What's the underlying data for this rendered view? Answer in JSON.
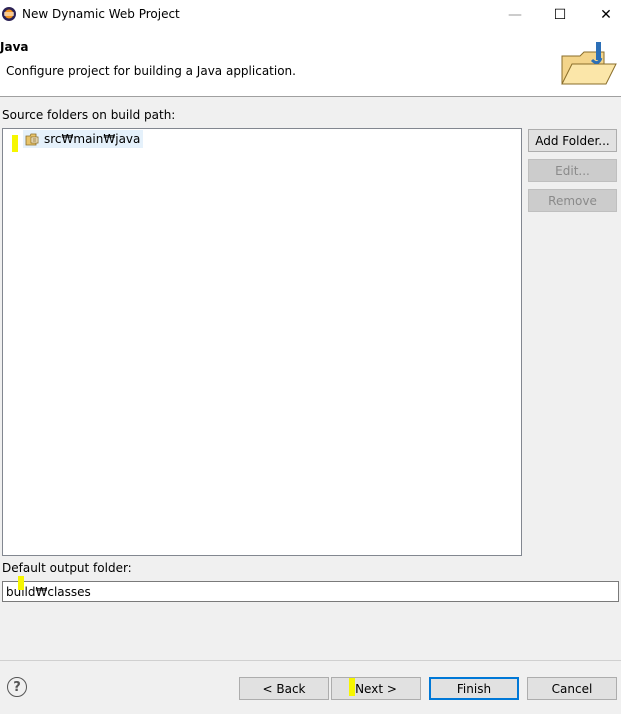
{
  "window": {
    "title": "New Dynamic Web Project",
    "controls": {
      "minimize": "—",
      "maximize": "☐",
      "close": "✕"
    }
  },
  "header": {
    "title": "Java",
    "description": "Configure project for building a Java application."
  },
  "source": {
    "label": "Source folders on build path:",
    "items": [
      {
        "label": "src₩main₩java",
        "icon": "source-folder-icon"
      }
    ]
  },
  "buttons": {
    "add_folder": "Add Folder...",
    "edit": "Edit...",
    "remove": "Remove"
  },
  "output": {
    "label": "Default output folder:",
    "value": "build₩classes"
  },
  "footer": {
    "help": "?",
    "back": "< Back",
    "next": "Next >",
    "finish": "Finish",
    "cancel": "Cancel"
  },
  "colors": {
    "accent": "#0078d7",
    "highlight_marker": "#f6f600",
    "selection": "#e5f1fb"
  }
}
